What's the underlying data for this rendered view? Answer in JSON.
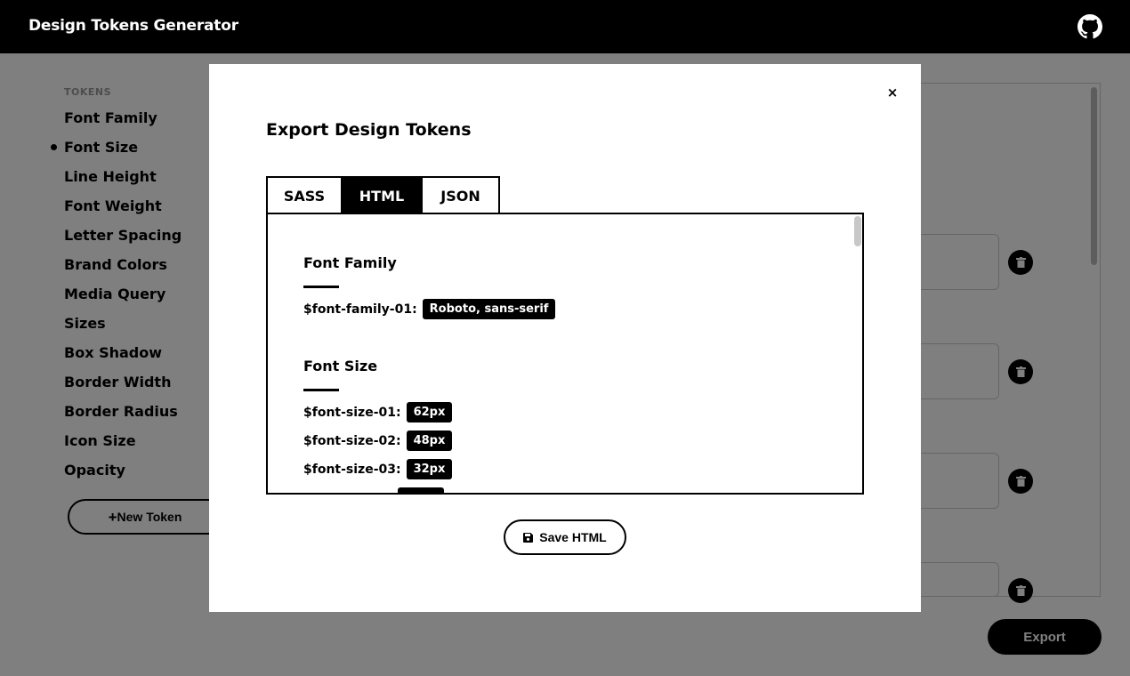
{
  "app": {
    "title": "Design Tokens Generator",
    "github_icon": "github-icon"
  },
  "sidebar": {
    "heading": "TOKENS",
    "items": [
      {
        "label": "Font Family"
      },
      {
        "label": "Font Size",
        "active": true
      },
      {
        "label": "Line Height"
      },
      {
        "label": "Font Weight"
      },
      {
        "label": "Letter Spacing"
      },
      {
        "label": "Brand Colors"
      },
      {
        "label": "Media Query"
      },
      {
        "label": "Sizes"
      },
      {
        "label": "Box Shadow"
      },
      {
        "label": "Border Width"
      },
      {
        "label": "Border Radius"
      },
      {
        "label": "Icon Size"
      },
      {
        "label": "Opacity"
      }
    ],
    "new_token_label": "New Token"
  },
  "footer": {
    "export_label": "Export"
  },
  "modal": {
    "title": "Export Design Tokens",
    "close_label": "×",
    "tabs": [
      {
        "label": "SASS",
        "active": false
      },
      {
        "label": "HTML",
        "active": true
      },
      {
        "label": "JSON",
        "active": false
      }
    ],
    "groups": [
      {
        "title": "Font Family",
        "tokens": [
          {
            "name": "$font-family-01:",
            "value": "Roboto, sans-serif"
          }
        ]
      },
      {
        "title": "Font Size",
        "tokens": [
          {
            "name": "$font-size-01:",
            "value": "62px"
          },
          {
            "name": "$font-size-02:",
            "value": "48px"
          },
          {
            "name": "$font-size-03:",
            "value": "32px"
          }
        ]
      }
    ],
    "save_label": "Save HTML"
  },
  "colors": {
    "accent": "#000000",
    "overlay": "rgba(0,0,0,0.5)",
    "muted": "#9a9a9a"
  }
}
